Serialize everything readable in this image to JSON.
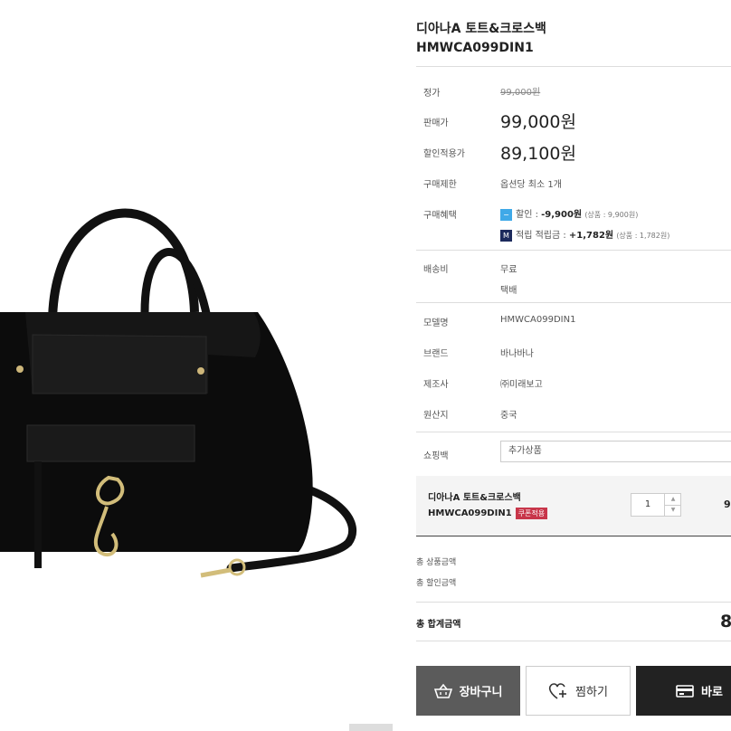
{
  "product": {
    "title_line1": "디아나A 토트&크로스백",
    "title_line2": "HMWCA099DIN1",
    "image_alt": "black tote crossbody bag"
  },
  "info_rows": {
    "list_price_label": "정가",
    "list_price": "99,000원",
    "sale_price_label": "판매가",
    "sale_price": "99,000원",
    "discount_price_label": "할인적용가",
    "discount_price": "89,100원",
    "limit_label": "구매제한",
    "limit_value": "옵션당 최소 1개",
    "benefit_label": "구매혜택",
    "benefit_sale_prefix": "할인 : ",
    "benefit_sale_amount": "-9,900원",
    "benefit_sale_note": "(상품 : 9,900원)",
    "benefit_mile_prefix": "적립 적립금 : ",
    "benefit_mile_amount": "+1,782원",
    "benefit_mile_note": "(상품 : 1,782원)",
    "shipping_label": "배송비",
    "shipping_value": "무료",
    "shipping_method": "택배",
    "model_label": "모델명",
    "model_value": "HMWCA099DIN1",
    "brand_label": "브랜드",
    "brand_value": "바나바나",
    "maker_label": "제조사",
    "maker_value": "㈜미래보고",
    "origin_label": "원산지",
    "origin_value": "중국",
    "shopping_bag_label": "쇼핑백",
    "shopping_bag_select": "추가상품"
  },
  "option": {
    "name_line1": "디아나A 토트&크로스백",
    "name_line2": "HMWCA099DIN1",
    "coupon_badge": "쿠폰적용",
    "quantity": "1",
    "price_partial": "9"
  },
  "summary": {
    "product_total_label": "총 상품금액",
    "discount_total_label": "총 할인금액",
    "grand_total_label": "총 합계금액",
    "grand_total_partial": "8"
  },
  "buttons": {
    "cart": "장바구니",
    "wish": "찜하기",
    "buy": "바로"
  },
  "icons": {
    "sale": "sale-badge-icon",
    "mileage": "mileage-badge-icon",
    "cart": "basket-icon",
    "wish": "heart-plus-icon",
    "buy": "card-icon"
  },
  "colors": {
    "cart_button": "#5b5b5b",
    "buy_button": "#222222",
    "coupon_badge": "#c8364a",
    "sale_icon": "#3fa9e8",
    "mileage_icon": "#1c2a5c"
  }
}
